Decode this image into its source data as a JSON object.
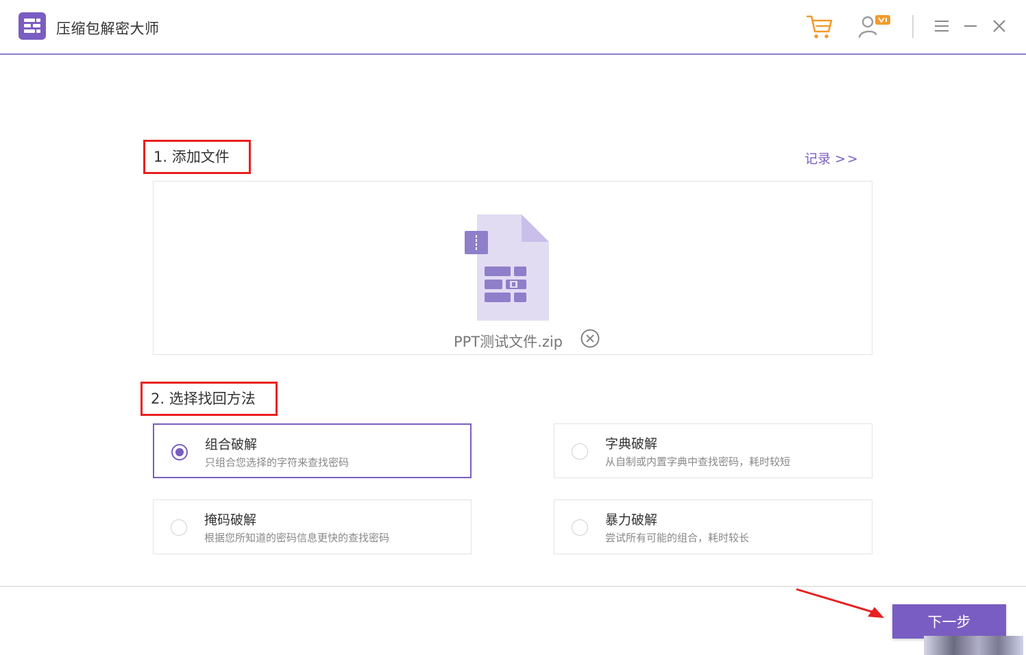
{
  "app": {
    "title": "压缩包解密大师"
  },
  "titlebar": {
    "icons": [
      "cart-icon",
      "user-vip-icon",
      "menu-icon",
      "minimize-icon",
      "close-icon"
    ],
    "accent_orange": "#f39a2b"
  },
  "step1": {
    "label": "1. 添加文件",
    "records_label": "记录",
    "records_arrows": ">>"
  },
  "file": {
    "name": "PPT测试文件.zip",
    "icon": "zip-file-icon",
    "remove_icon": "remove-circle-x-icon"
  },
  "step2": {
    "label": "2. 选择找回方法",
    "options": [
      {
        "title": "组合破解",
        "desc": "只组合您选择的字符来查找密码",
        "selected": true
      },
      {
        "title": "字典破解",
        "desc": "从自制或内置字典中查找密码，耗时较短",
        "selected": false
      },
      {
        "title": "掩码破解",
        "desc": "根据您所知道的密码信息更快的查找密码",
        "selected": false
      },
      {
        "title": "暴力破解",
        "desc": "尝试所有可能的组合，耗时较长",
        "selected": false
      }
    ]
  },
  "footer": {
    "next_label": "下一步"
  },
  "colors": {
    "accent": "#7a5dc2",
    "annotation_red": "#e8201f"
  }
}
